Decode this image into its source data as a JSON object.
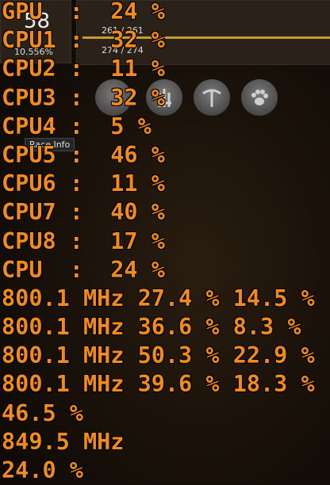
{
  "game_ui": {
    "level_value": "58",
    "xp_percent": "10.556%",
    "stat_1": "261 / 261",
    "stat_2": "274 / 274",
    "tooltip_label": "Race Info",
    "skill_icons": [
      "farming-icon",
      "mining-icon",
      "paw-icon"
    ],
    "accent_color": "#c79a2e"
  },
  "overlay": {
    "text_color": "#f28a1c",
    "lines": [
      "GPU  :  24 %",
      "CPU1 :  32 %",
      "CPU2 :  11 %",
      "CPU3 :  32 %",
      "CPU4 :  5 %",
      "CPU5 :  46 %",
      "CPU6 :  11 %",
      "CPU7 :  40 %",
      "CPU8 :  17 %",
      "CPU  :  24 %",
      "800.1 MHz 27.4 % 14.5 %",
      "800.1 MHz 36.6 % 8.3 %",
      "800.1 MHz 50.3 % 22.9 %",
      "800.1 MHz 39.6 % 18.3 %",
      "46.5 %",
      "849.5 MHz",
      "24.0 %"
    ]
  }
}
